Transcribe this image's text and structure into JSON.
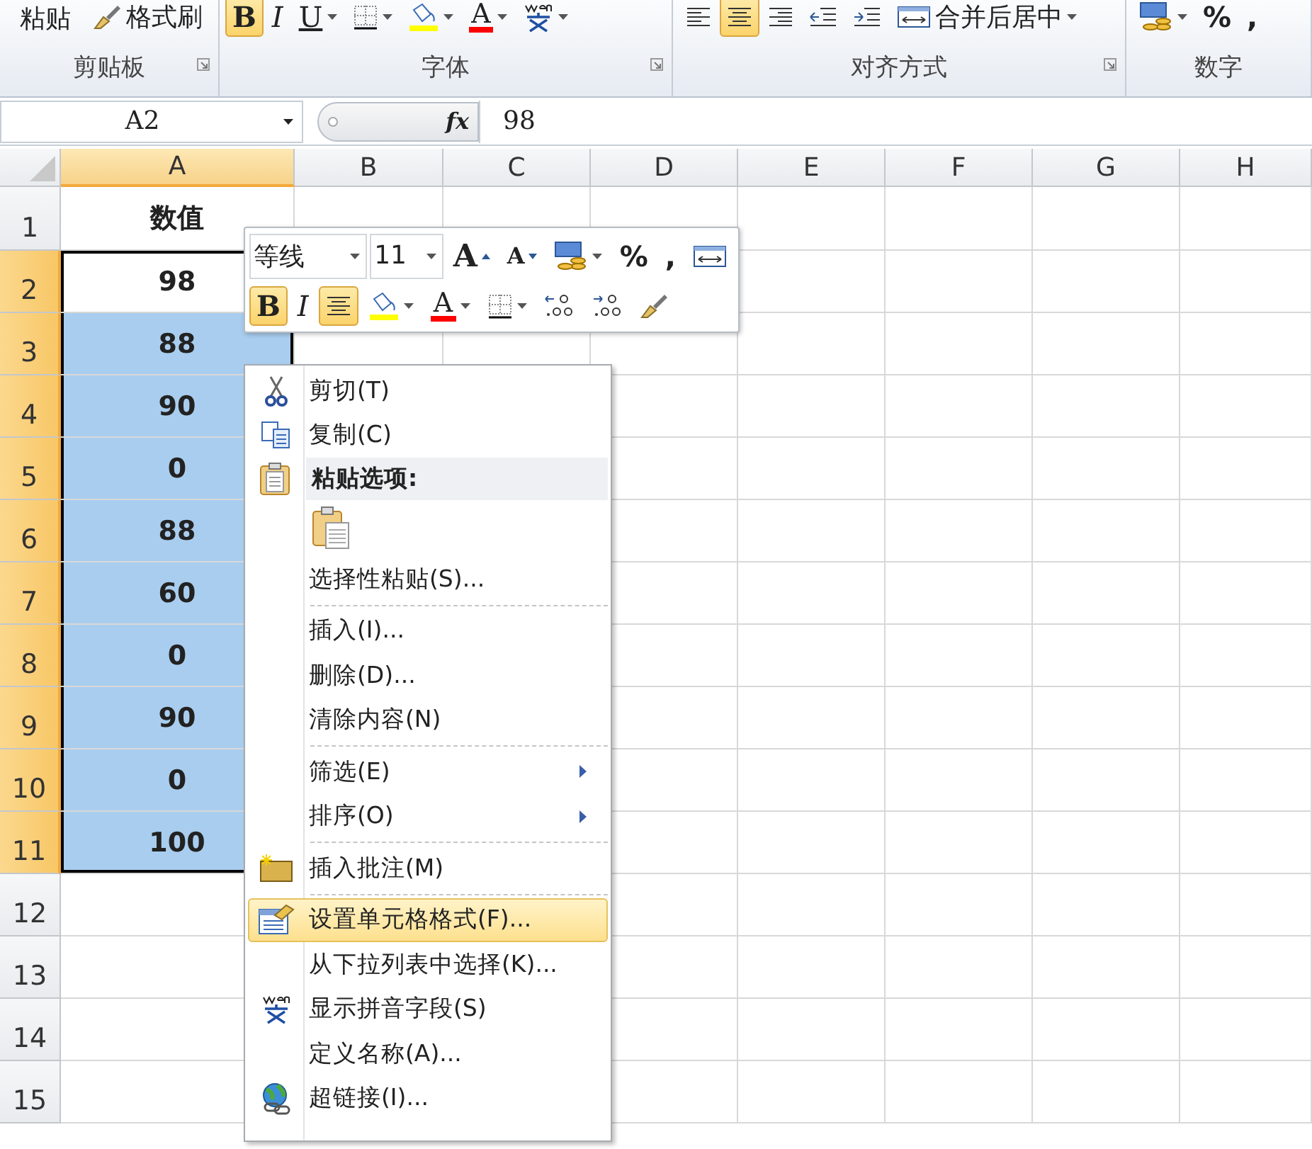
{
  "ribbon": {
    "groups": [
      {
        "label": "剪贴板",
        "launcher": true,
        "items": [
          {
            "kind": "paste",
            "text": "粘贴"
          },
          {
            "kind": "painter",
            "text": "格式刷"
          }
        ]
      },
      {
        "label": "字体",
        "launcher": true,
        "items": [
          {
            "kind": "bold",
            "text": "B",
            "selected": true
          },
          {
            "kind": "italic",
            "text": "I",
            "selected": false
          },
          {
            "kind": "underline",
            "text": "U",
            "selected": false
          },
          {
            "kind": "border"
          },
          {
            "kind": "fill"
          },
          {
            "kind": "fontcolor",
            "text": "A"
          },
          {
            "kind": "phonetic"
          }
        ]
      },
      {
        "label": "对齐方式",
        "launcher": true,
        "items": [
          {
            "kind": "alignleft",
            "selected": false
          },
          {
            "kind": "aligncenter",
            "selected": true
          },
          {
            "kind": "alignright",
            "selected": false
          },
          {
            "kind": "outdent"
          },
          {
            "kind": "indent"
          },
          {
            "kind": "merge",
            "text": "合并后居中"
          }
        ]
      },
      {
        "label": "数字",
        "launcher": false,
        "items": [
          {
            "kind": "currency"
          },
          {
            "kind": "symbol",
            "text": "%"
          },
          {
            "kind": "symbol",
            "text": ","
          }
        ]
      }
    ]
  },
  "formula_bar": {
    "name_box": "A2",
    "fx_label": "fx",
    "formula": "98"
  },
  "sheet": {
    "columns": [
      {
        "label": "A",
        "selected": true
      },
      {
        "label": "B",
        "selected": false
      },
      {
        "label": "C",
        "selected": false
      },
      {
        "label": "D",
        "selected": false
      },
      {
        "label": "E",
        "selected": false
      },
      {
        "label": "F",
        "selected": false
      },
      {
        "label": "G",
        "selected": false
      },
      {
        "label": "H",
        "selected": false
      }
    ],
    "rows": [
      {
        "label": "1",
        "selected": false,
        "value": "数值"
      },
      {
        "label": "2",
        "selected": true,
        "active": true,
        "value": "98"
      },
      {
        "label": "3",
        "selected": true,
        "active": false,
        "value": "88"
      },
      {
        "label": "4",
        "selected": true,
        "active": false,
        "value": "90"
      },
      {
        "label": "5",
        "selected": true,
        "active": false,
        "value": "0"
      },
      {
        "label": "6",
        "selected": true,
        "active": false,
        "value": "88"
      },
      {
        "label": "7",
        "selected": true,
        "active": false,
        "value": "60"
      },
      {
        "label": "8",
        "selected": true,
        "active": false,
        "value": "0"
      },
      {
        "label": "9",
        "selected": true,
        "active": false,
        "value": "90"
      },
      {
        "label": "10",
        "selected": true,
        "active": false,
        "value": "0"
      },
      {
        "label": "11",
        "selected": true,
        "active": false,
        "value": "100"
      },
      {
        "label": "12",
        "selected": false
      },
      {
        "label": "13",
        "selected": false
      },
      {
        "label": "14",
        "selected": false
      },
      {
        "label": "15",
        "selected": false
      }
    ]
  },
  "mini_toolbar": {
    "font": "等线",
    "size": "11",
    "rows": [
      [
        {
          "kind": "grow",
          "text": "A"
        },
        {
          "kind": "shrink",
          "text": "A"
        },
        {
          "kind": "currency"
        },
        {
          "kind": "symbol",
          "text": "%"
        },
        {
          "kind": "symbol",
          "text": ","
        },
        {
          "kind": "merge"
        }
      ],
      [
        {
          "kind": "bold",
          "text": "B",
          "selected": true
        },
        {
          "kind": "italic",
          "text": "I",
          "selected": false
        },
        {
          "kind": "aligncenter",
          "selected": true
        },
        {
          "kind": "fill"
        },
        {
          "kind": "fontcolor",
          "text": "A"
        },
        {
          "kind": "border"
        },
        {
          "kind": "incdecimal"
        },
        {
          "kind": "decdecimal"
        },
        {
          "kind": "painter"
        }
      ]
    ]
  },
  "context_menu": {
    "items": [
      {
        "kind": "cut",
        "label": "剪切(T)",
        "selected": false
      },
      {
        "kind": "copy",
        "label": "复制(C)",
        "selected": false
      },
      {
        "kind": "heading",
        "label": "粘贴选项:"
      },
      {
        "kind": "pasteoption"
      },
      {
        "kind": "plain",
        "label": "选择性粘贴(S)...",
        "selected": false
      },
      {
        "kind": "plain",
        "label": "插入(I)...",
        "selected": false,
        "separator_before": true
      },
      {
        "kind": "plain",
        "label": "删除(D)...",
        "selected": false
      },
      {
        "kind": "plain",
        "label": "清除内容(N)",
        "selected": false
      },
      {
        "kind": "plain",
        "label": "筛选(E)",
        "selected": false,
        "submenu": true,
        "separator_before": true
      },
      {
        "kind": "plain",
        "label": "排序(O)",
        "selected": false,
        "submenu": true
      },
      {
        "kind": "comment",
        "label": "插入批注(M)",
        "selected": false,
        "separator_before": true
      },
      {
        "kind": "format",
        "label": "设置单元格格式(F)...",
        "selected": true,
        "separator_before": true
      },
      {
        "kind": "plain",
        "label": "从下拉列表中选择(K)...",
        "selected": false
      },
      {
        "kind": "phonetic",
        "label": "显示拼音字段(S)",
        "selected": false
      },
      {
        "kind": "plain",
        "label": "定义名称(A)...",
        "selected": false
      },
      {
        "kind": "link",
        "label": "超链接(I)...",
        "selected": false
      }
    ]
  }
}
